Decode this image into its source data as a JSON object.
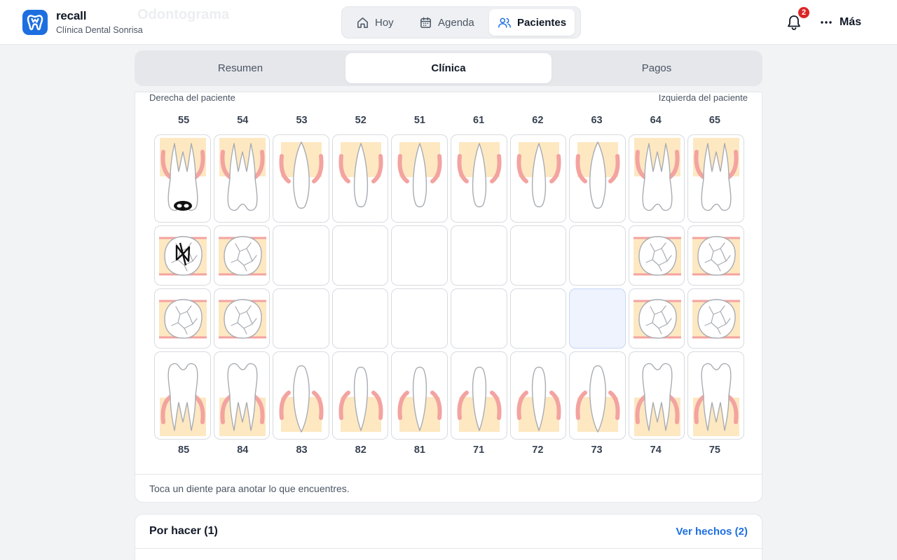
{
  "app": {
    "name": "recall",
    "clinic": "Clínica Dental Sonrisa",
    "background_title": "Odontograma"
  },
  "nav": {
    "items": [
      {
        "label": "Hoy",
        "icon": "home-icon",
        "active": false
      },
      {
        "label": "Agenda",
        "icon": "calendar-icon",
        "active": false
      },
      {
        "label": "Pacientes",
        "icon": "users-icon",
        "active": true
      }
    ]
  },
  "notifications": {
    "count": "2"
  },
  "more": {
    "label": "Más"
  },
  "tabs": [
    {
      "label": "Resumen",
      "active": false
    },
    {
      "label": "Clínica",
      "active": true
    },
    {
      "label": "Pagos",
      "active": false
    }
  ],
  "odontogram": {
    "right_label": "Derecha del paciente",
    "left_label": "Izquierda del paciente",
    "upper_numbers": [
      "55",
      "54",
      "53",
      "52",
      "51",
      "61",
      "62",
      "63",
      "64",
      "65"
    ],
    "lower_numbers": [
      "85",
      "84",
      "83",
      "82",
      "81",
      "71",
      "72",
      "73",
      "74",
      "75"
    ],
    "upper_types": [
      "molar",
      "molar",
      "canine",
      "incisor",
      "incisor",
      "incisor",
      "incisor",
      "canine",
      "molar",
      "molar"
    ],
    "lower_types": [
      "molar",
      "molar",
      "canine",
      "incisor",
      "incisor",
      "incisor",
      "incisor",
      "canine",
      "molar",
      "molar"
    ],
    "annotations": [
      {
        "tooth": "55",
        "view": "side",
        "mark": "filled-cavity"
      },
      {
        "tooth": "55",
        "view": "occlusal",
        "mark": "bowtie"
      }
    ],
    "selected_tooth": "73",
    "footer_hint": "Toca un diente para anotar lo que encuentres.",
    "colors": {
      "gum": "#f3a3a0",
      "bone": "#fde8c2",
      "outline": "#a8acb2"
    }
  },
  "todo": {
    "title": "Por hacer (1)",
    "done_link": "Ver hechos (2)"
  }
}
